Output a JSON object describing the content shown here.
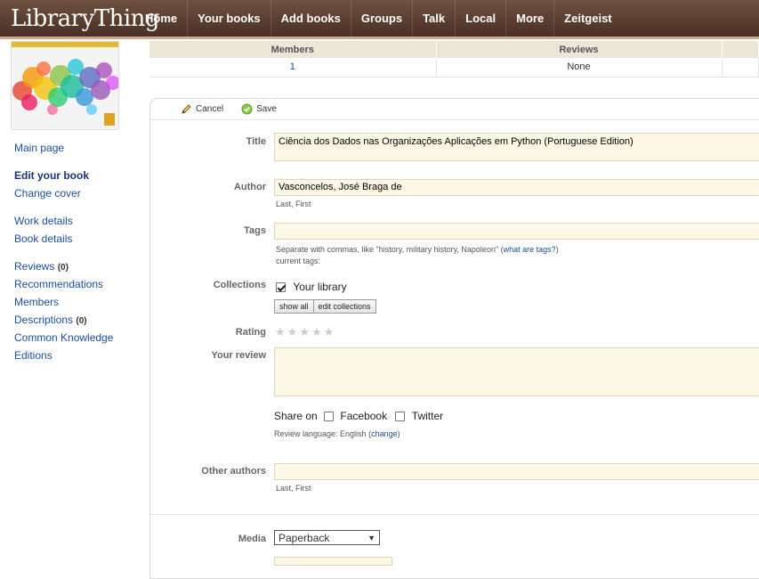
{
  "header": {
    "logo": "LibraryThing",
    "nav": [
      "Home",
      "Your books",
      "Add books",
      "Groups",
      "Talk",
      "Local",
      "More",
      "Zeitgeist"
    ]
  },
  "sidebar": {
    "main_page": "Main page",
    "edit_book": "Edit your book",
    "change_cover": "Change cover",
    "work_details": "Work details",
    "book_details": "Book details",
    "reviews": "Reviews",
    "reviews_count": "(0)",
    "recommendations": "Recommendations",
    "members": "Members",
    "descriptions": "Descriptions",
    "descriptions_count": "(0)",
    "common_knowledge": "Common Knowledge",
    "editions": "Editions"
  },
  "stats": {
    "members_header": "Members",
    "reviews_header": "Reviews",
    "members_value": "1",
    "reviews_value": "None"
  },
  "toolbar": {
    "cancel": "Cancel",
    "save": "Save"
  },
  "form": {
    "title_label": "Title",
    "title_value": "Ciência dos Dados nas Organizações Aplicações em Python (Portuguese Edition)",
    "author_label": "Author",
    "author_value": "Vasconcelos, José Braga de",
    "author_hint": "Last, First",
    "tags_label": "Tags",
    "tags_value": "",
    "tags_hint": "Separate with commas, like \"history, military history, Napoleon\" (",
    "tags_hint_link": "what are tags?",
    "tags_hint_end": ")",
    "current_tags": "current tags:",
    "collections_label": "Collections",
    "collection_your_library": "Your library",
    "show_all": "show all",
    "edit_collections": "edit collections",
    "rating_label": "Rating",
    "review_label": "Your review",
    "review_value": "",
    "share_on": "Share on",
    "facebook": "Facebook",
    "twitter": "Twitter",
    "review_language": "Review language: English (",
    "change": "change",
    "review_language_end": ")",
    "other_authors_label": "Other authors",
    "other_authors_value": "",
    "other_authors_hint": "Last, First",
    "media_label": "Media",
    "media_value": "Paperback"
  },
  "colors": {
    "nav_bg": "#5a3d2f",
    "link": "#1c4fa0",
    "field_bg": "#fdf8e6",
    "table_header_bg": "#ece6d6"
  }
}
